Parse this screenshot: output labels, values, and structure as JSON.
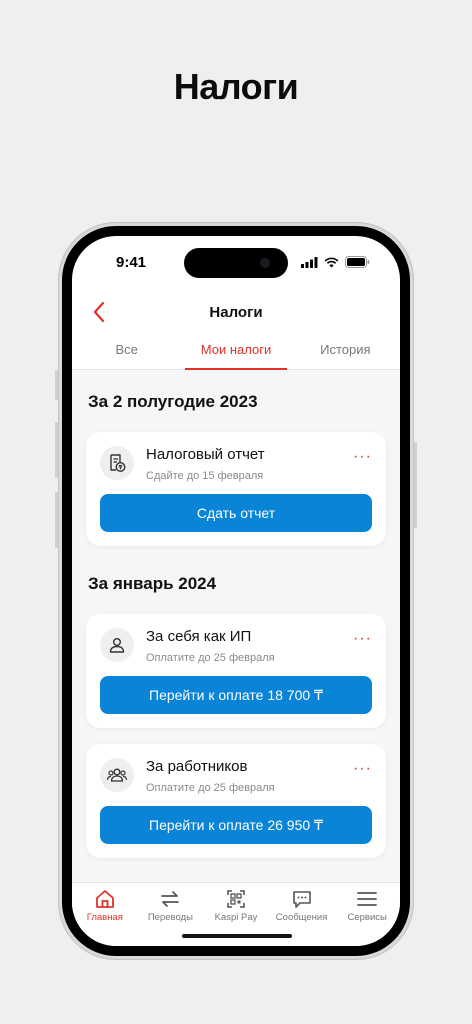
{
  "headline": "Налоги",
  "status": {
    "time": "9:41"
  },
  "screen": {
    "title": "Налоги",
    "tabs": [
      {
        "label": "Все",
        "active": false
      },
      {
        "label": "Мои налоги",
        "active": true
      },
      {
        "label": "История",
        "active": false
      }
    ]
  },
  "sections": [
    {
      "title": "За 2 полугодие 2023",
      "cards": [
        {
          "icon": "tax-document-icon",
          "name": "Налоговый отчет",
          "sub": "Сдайте до 15 февраля",
          "action": "Сдать отчет"
        }
      ]
    },
    {
      "title": "За январь 2024",
      "cards": [
        {
          "icon": "person-icon",
          "name": "За себя как ИП",
          "sub": "Оплатите до 25 февраля",
          "action": "Перейти к оплате 18 700 ₸"
        },
        {
          "icon": "people-icon",
          "name": "За работников",
          "sub": "Оплатите до 25 февраля",
          "action": "Перейти к оплате 26 950 ₸"
        }
      ]
    }
  ],
  "more_glyph": "···",
  "bottom_nav": [
    {
      "label": "Главная",
      "icon": "home-icon",
      "active": true
    },
    {
      "label": "Переводы",
      "icon": "transfer-icon",
      "active": false
    },
    {
      "label": "Kaspi Pay",
      "icon": "qr-icon",
      "active": false
    },
    {
      "label": "Сообщения",
      "icon": "chat-icon",
      "active": false
    },
    {
      "label": "Сервисы",
      "icon": "menu-icon",
      "active": false
    }
  ],
  "colors": {
    "accent": "#e0322a",
    "button": "#0a84d6",
    "background": "#efefef"
  }
}
